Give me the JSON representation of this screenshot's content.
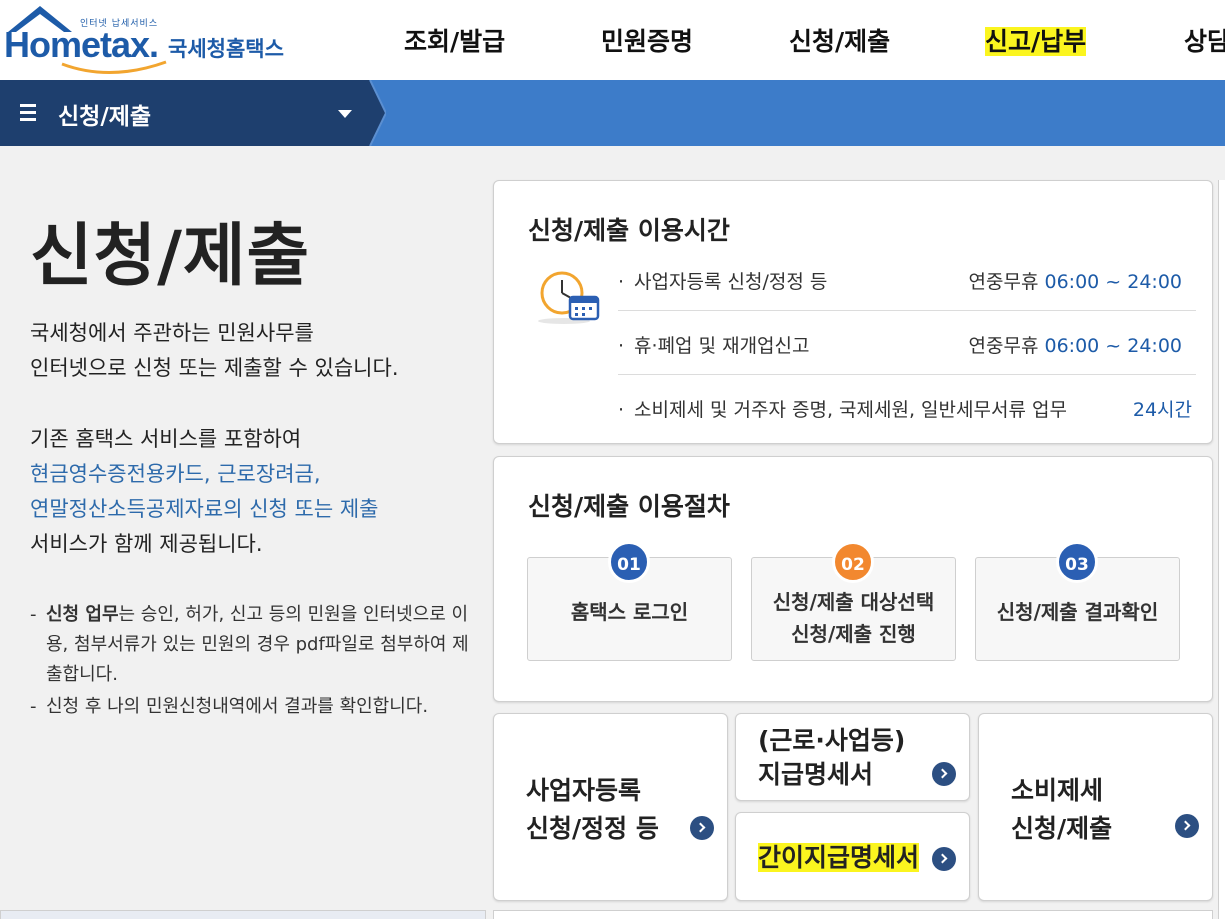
{
  "header": {
    "logo_tag": "인터넷 납세서비스",
    "logo_word": "Hometax.",
    "logo_kor": "국세청홈택스",
    "menu": [
      {
        "label": "조회/발급",
        "highlight": false
      },
      {
        "label": "민원증명",
        "highlight": false
      },
      {
        "label": "신청/제출",
        "highlight": false
      },
      {
        "label": "신고/납부",
        "highlight": true
      },
      {
        "label": "상담",
        "highlight": false
      }
    ]
  },
  "nav": {
    "title": "신청/제출"
  },
  "intro": {
    "title": "신청/제출",
    "para1": [
      "국세청에서 주관하는 민원사무를",
      "인터넷으로 신청 또는 제출할 수 있습니다."
    ],
    "para2_lead": "기존 홈택스 서비스를 포함하여",
    "para2_blue": [
      "현금영수증전용카드, 근로장려금,",
      "연말정산소득공제자료의 신청 또는 제출"
    ],
    "para2_tail": "서비스가 함께 제공됩니다.",
    "note1_bold": "신청 업무",
    "note1_rest": "는 승인, 허가, 신고 등의 민원을 인터넷으로 이용, 첨부서류가 있는 민원의 경우 pdf파일로 첨부하여 제출합니다.",
    "note2": "신청 후 나의 민원신청내역에서 결과를 확인합니다."
  },
  "hours_card": {
    "title": "신청/제출 이용시간",
    "rows": [
      {
        "label": "사업자등록 신청/정정 등",
        "prefix": "연중무휴 ",
        "time": "06:00 ~ 24:00"
      },
      {
        "label": "휴·폐업 및 재개업신고",
        "prefix": "연중무휴 ",
        "time": "06:00 ~ 24:00"
      },
      {
        "label": "소비제세 및 거주자 증명, 국제세원, 일반세무서류 업무",
        "prefix": "",
        "time": "24시간"
      }
    ]
  },
  "steps_card": {
    "title": "신청/제출 이용절차",
    "steps": [
      {
        "num": "01",
        "label": "홈택스 로그인"
      },
      {
        "num": "02",
        "label": "신청/제출 대상선택\n신청/제출 진행"
      },
      {
        "num": "03",
        "label": "신청/제출 결과확인"
      }
    ]
  },
  "services": {
    "business_reg": "사업자등록\n신청/정정 등",
    "payment_statement": "(근로·사업등)\n지급명세서",
    "simple_statement": "간이지급명세서",
    "consumption_tax": "소비제세\n신청/제출"
  },
  "colors": {
    "brand_blue": "#1d5ba8",
    "nav_dark": "#1e3f6e",
    "nav_light": "#3d7cc9",
    "highlight": "#fbf51f",
    "step_orange": "#f2882f"
  }
}
